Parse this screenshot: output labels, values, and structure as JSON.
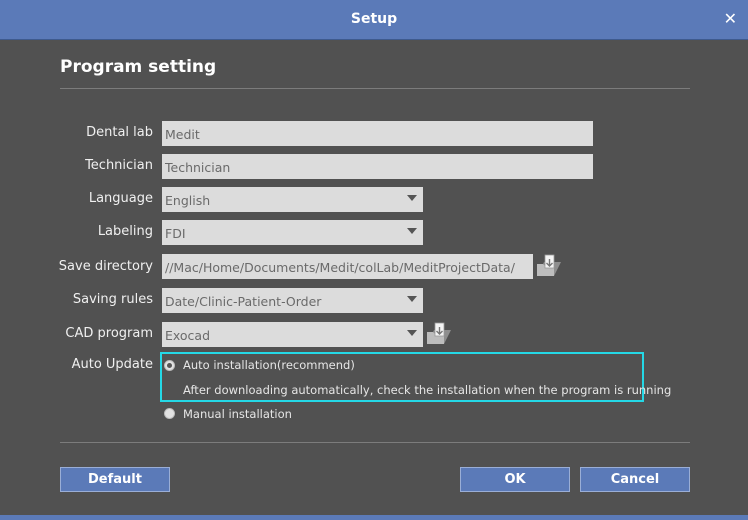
{
  "window": {
    "title": "Setup",
    "close_glyph": "✕"
  },
  "section": {
    "title": "Program setting"
  },
  "fields": {
    "dental_lab": {
      "label": "Dental lab",
      "value": "Medit"
    },
    "technician": {
      "label": "Technician",
      "value": "Technician"
    },
    "language": {
      "label": "Language",
      "value": "English"
    },
    "labeling": {
      "label": "Labeling",
      "value": "FDI"
    },
    "save_directory": {
      "label": "Save directory",
      "value": "//Mac/Home/Documents/Medit/colLab/MeditProjectData/"
    },
    "saving_rules": {
      "label": "Saving rules",
      "value": "Date/Clinic-Patient-Order"
    },
    "cad_program": {
      "label": "CAD program",
      "value": "Exocad"
    }
  },
  "auto_update": {
    "label": "Auto Update",
    "options": [
      {
        "label": "Auto installation(recommend)",
        "selected": true
      },
      {
        "label": "Manual installation",
        "selected": false
      }
    ],
    "description": "After downloading automatically, check the installation when the program is running"
  },
  "buttons": {
    "default": "Default",
    "ok": "OK",
    "cancel": "Cancel"
  },
  "colors": {
    "accent": "#5b7ab8",
    "highlight": "#24d8e6",
    "background": "#515151"
  },
  "icons": {
    "browse": "folder-download-icon",
    "close": "close-icon"
  }
}
